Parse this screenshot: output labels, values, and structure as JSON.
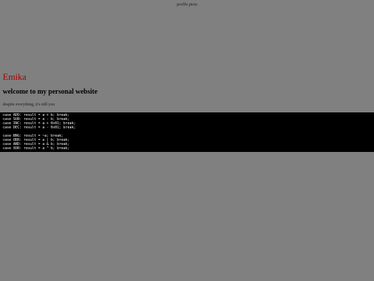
{
  "profile": {
    "alt_text": "profile pictu"
  },
  "header": {
    "title": "Emika",
    "welcome": "welcome to my personal website",
    "tagline": "despite everything, it's still you"
  },
  "code": {
    "lines": [
      "case ADD: result = a + b; break;",
      "case SUB: result = a - b; break;",
      "case INC: result = a + 0x01; break;",
      "case DEC: result = a - 0x01; break;",
      "",
      "case BNG: result = ~a; break;",
      "case ORR: result = a | b; break;",
      "case AND: result = a & b; break;",
      "case XOR: result = a ^ b; break;"
    ]
  },
  "colors": {
    "background": "#808080",
    "title": "#a00000",
    "code_bg": "#000000",
    "code_fg": "#ffffff"
  }
}
